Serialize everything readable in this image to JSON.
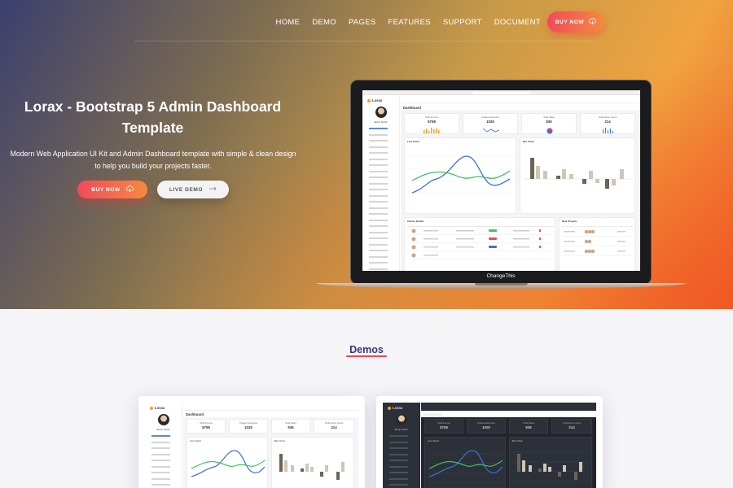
{
  "nav": {
    "items": [
      "HOME",
      "DEMO",
      "PAGES",
      "FEATURES",
      "SUPPORT",
      "DOCUMENT"
    ],
    "buy_label": "BUY NOW"
  },
  "hero": {
    "title": "Lorax - Bootstrap 5 Admin Dashboard Template",
    "subtitle": "Modern Web Application UI Kit and Admin Dashboard template with simple & clean design to help you build your projects faster.",
    "buy_label": "BUY NOW",
    "live_label": "LIVE DEMO"
  },
  "laptop": {
    "brand": "ChangeThis",
    "dashboard": {
      "logo": "Lorax",
      "user": "Emily Smith",
      "page": "Dashboard",
      "cards": [
        {
          "title": "Total Income",
          "value": "$758"
        },
        {
          "title": "Unique Response",
          "value": "1025"
        },
        {
          "title": "Total Sales",
          "value": "936"
        },
        {
          "title": "Total Active Users",
          "value": "214"
        }
      ],
      "line_chart_title": "Line Chart",
      "bar_chart_title": "Bar Chart",
      "table_title": "Clients Details",
      "projects_title": "New Projects"
    }
  },
  "demos": {
    "title": "Demos"
  },
  "colors": {
    "accent_red": "#f04b5c",
    "accent_orange": "#f58a40",
    "demos_title": "#3a3580",
    "chart_blue": "#3f6fd8",
    "chart_green": "#3fc25a",
    "bar_dark": "#6b6458",
    "bar_light": "#cfc6b8"
  }
}
